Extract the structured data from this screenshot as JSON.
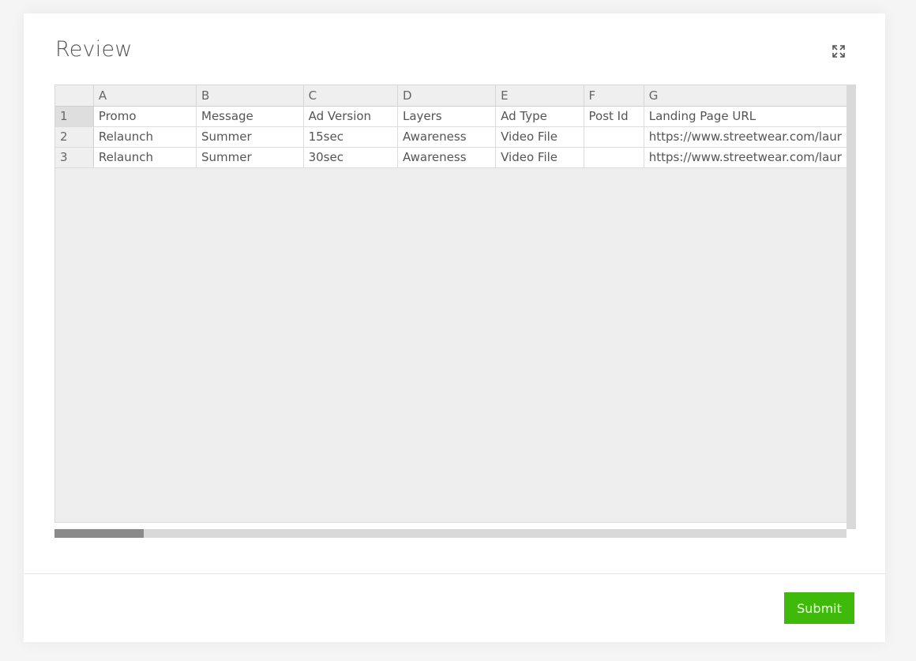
{
  "modal": {
    "title": "Review",
    "expand_icon": "expand-icon",
    "submit_label": "Submit",
    "colors": {
      "submit": "#3fba0b",
      "grid_background": "#eeeeee",
      "scroll_thumb": "#8a8a8a"
    }
  },
  "sheet": {
    "column_letters": [
      "A",
      "B",
      "C",
      "D",
      "E",
      "F",
      "G"
    ],
    "rows": [
      {
        "num": "1",
        "cells": [
          "Promo",
          "Message",
          "Ad Version",
          "Layers",
          "Ad Type",
          "Post Id",
          "Landing Page URL"
        ]
      },
      {
        "num": "2",
        "cells": [
          "Relaunch",
          "Summer",
          "15sec",
          "Awareness",
          "Video File",
          "",
          "https://www.streetwear.com/laur"
        ]
      },
      {
        "num": "3",
        "cells": [
          "Relaunch",
          "Summer",
          "30sec",
          "Awareness",
          "Video File",
          "",
          "https://www.streetwear.com/laur"
        ]
      }
    ]
  }
}
